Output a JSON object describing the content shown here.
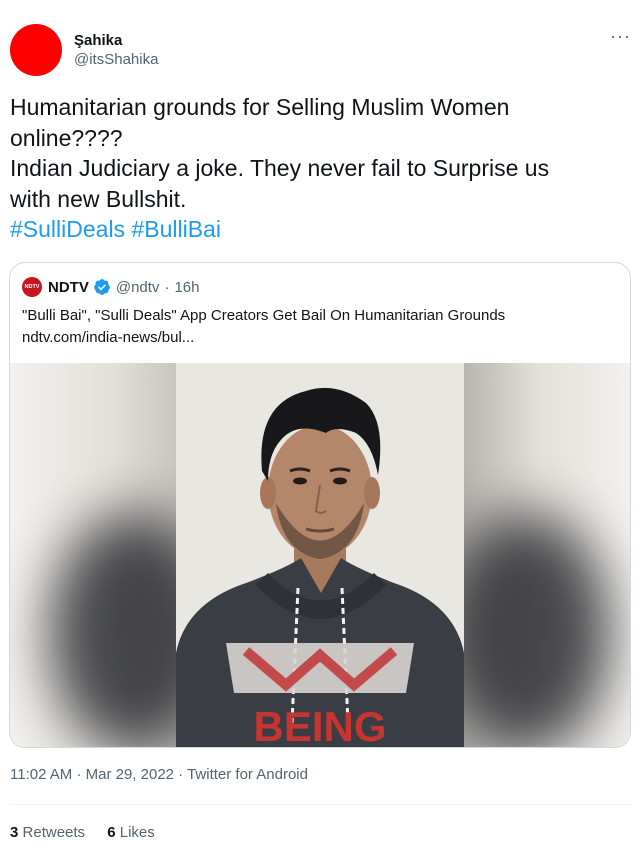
{
  "author": {
    "name": "Şahika",
    "handle": "@itsShahika",
    "avatar_color": "#ff0000"
  },
  "menu": {
    "more_icon": "more-horizontal-icon",
    "label": "···"
  },
  "tweet": {
    "lines": [
      "Humanitarian grounds for Selling Muslim Women",
      "online????",
      "Indian Judiciary a joke. They never fail to Surprise us",
      "with new Bullshit."
    ],
    "hashtags": [
      "#SulliDeals",
      "#BulliBai"
    ]
  },
  "quote": {
    "logo_text": "NDTV",
    "name": "NDTV",
    "verified_icon": "verified-badge-icon",
    "handle": "@ndtv",
    "separator": "·",
    "time": "16h",
    "text": "\"Bulli Bai\", \"Sulli Deals\" App Creators Get Bail On Humanitarian Grounds",
    "link": "ndtv.com/india-news/bul...",
    "image": {
      "shirt_text": "BEING"
    }
  },
  "meta": {
    "time": "11:02 AM",
    "date": "Mar 29, 2022",
    "source": "Twitter for Android",
    "separator": "·"
  },
  "stats": {
    "retweets_count": "3",
    "retweets_label": "Retweets",
    "likes_count": "6",
    "likes_label": "Likes"
  },
  "colors": {
    "link": "#1d9bf0",
    "secondary_text": "#536471",
    "ndtv_red": "#c4161c",
    "verified": "#1d9bf0"
  }
}
